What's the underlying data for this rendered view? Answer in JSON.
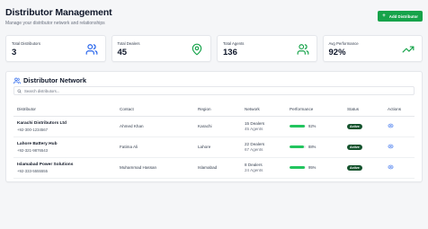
{
  "header": {
    "title": "Distributor Management",
    "subtitle": "Manage your distributor network and relationships",
    "add_button": "Add Distributor"
  },
  "stats": [
    {
      "label": "Total Distributors",
      "value": "3",
      "icon": "users-icon",
      "color": "#2563eb"
    },
    {
      "label": "Total Dealers",
      "value": "45",
      "icon": "map-pin-icon",
      "color": "#16a34a"
    },
    {
      "label": "Total Agents",
      "value": "136",
      "icon": "users-icon",
      "color": "#16a34a"
    },
    {
      "label": "Avg Performance",
      "value": "92%",
      "icon": "trending-up-icon",
      "color": "#16a34a"
    }
  ],
  "network": {
    "title": "Distributor Network",
    "search_placeholder": "Search distributors...",
    "columns": [
      "Distributor",
      "Contact",
      "Region",
      "Network",
      "Performance",
      "Status",
      "Actions"
    ],
    "rows": [
      {
        "name": "Karachi Distributors Ltd",
        "phone": "+92-300-1234567",
        "contact": "Ahmed Khan",
        "region": "Karachi",
        "dealers": "15 Dealers",
        "agents": "45 Agents",
        "performance": 92,
        "performance_label": "92%",
        "status": "Active"
      },
      {
        "name": "Lahore Battery Hub",
        "phone": "+92-321-9876543",
        "contact": "Fatima Ali",
        "region": "Lahore",
        "dealers": "22 Dealers",
        "agents": "67 Agents",
        "performance": 88,
        "performance_label": "88%",
        "status": "Active"
      },
      {
        "name": "Islamabad Power Solutions",
        "phone": "+92-333-5555555",
        "contact": "Muhammad Hassan",
        "region": "Islamabad",
        "dealers": "8 Dealers",
        "agents": "24 Agents",
        "performance": 95,
        "performance_label": "95%",
        "status": "Active"
      }
    ]
  },
  "colors": {
    "accent": "#16a34a",
    "status_badge": "#14532d",
    "blue_icon": "#2563eb",
    "progress": "#22c55e"
  }
}
